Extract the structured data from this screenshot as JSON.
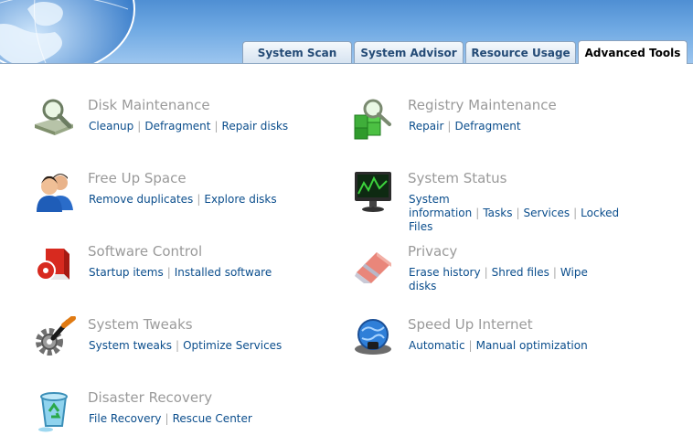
{
  "tabs": [
    {
      "label": "System Scan",
      "active": false
    },
    {
      "label": "System Advisor",
      "active": false
    },
    {
      "label": "Resource Usage",
      "active": false
    },
    {
      "label": "Advanced Tools",
      "active": true
    }
  ],
  "tools": [
    {
      "title": "Disk Maintenance",
      "icon": "disk-magnifier-icon",
      "links": [
        "Cleanup",
        "Defragment",
        "Repair disks"
      ]
    },
    {
      "title": "Registry Maintenance",
      "icon": "registry-cubes-icon",
      "links": [
        "Repair",
        "Defragment"
      ]
    },
    {
      "title": "Free Up Space",
      "icon": "users-icon",
      "links": [
        "Remove duplicates",
        "Explore disks"
      ]
    },
    {
      "title": "System Status",
      "icon": "monitor-chart-icon",
      "links": [
        "System information",
        "Tasks",
        "Services",
        "Locked Files"
      ]
    },
    {
      "title": "Software Control",
      "icon": "software-box-icon",
      "links": [
        "Startup items",
        "Installed software"
      ]
    },
    {
      "title": "Privacy",
      "icon": "eraser-icon",
      "links": [
        "Erase history",
        "Shred files",
        "Wipe disks"
      ]
    },
    {
      "title": "System Tweaks",
      "icon": "gear-screwdriver-icon",
      "links": [
        "System tweaks",
        "Optimize Services"
      ]
    },
    {
      "title": "Speed Up Internet",
      "icon": "globe-network-icon",
      "links": [
        "Automatic",
        "Manual optimization"
      ]
    },
    {
      "title": "Disaster Recovery",
      "icon": "recycle-bin-icon",
      "links": [
        "File Recovery",
        "Rescue Center"
      ]
    }
  ],
  "colors": {
    "link": "#0a4d8c",
    "title": "#9a9a9a",
    "header": "#5b9ad9"
  }
}
